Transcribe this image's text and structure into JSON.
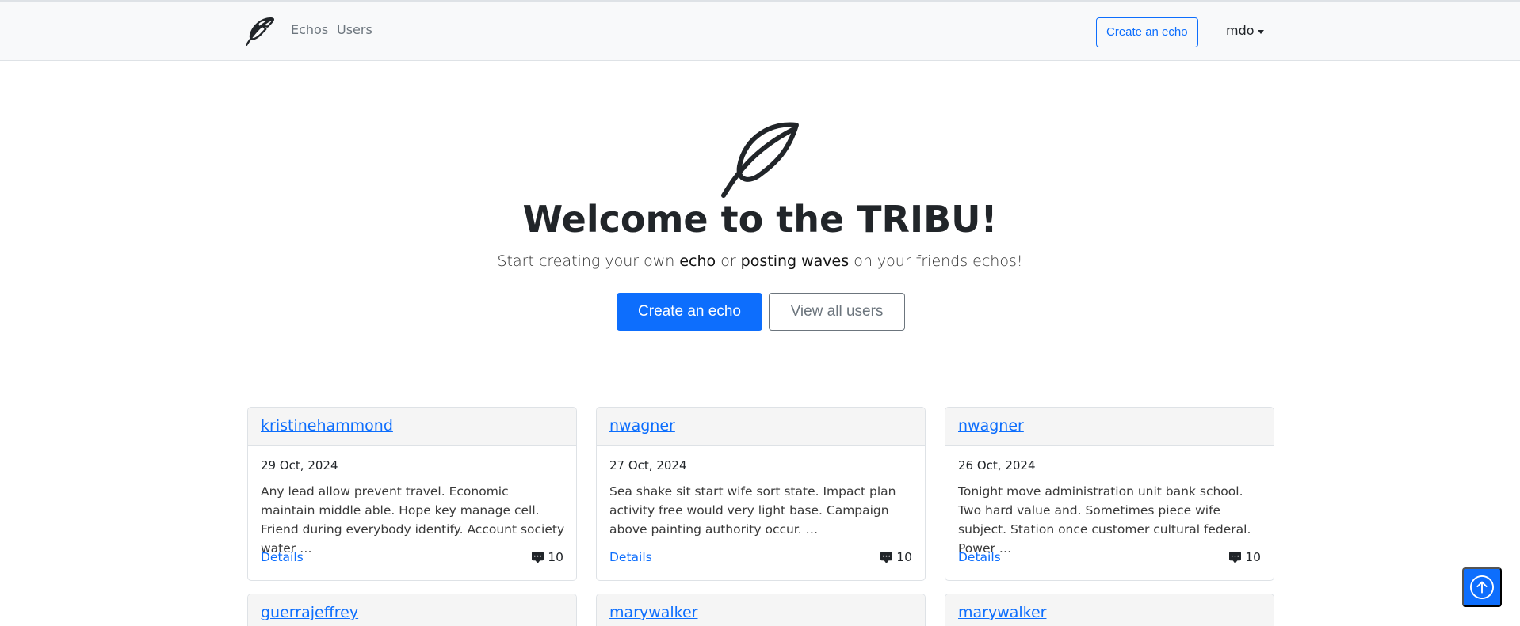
{
  "navbar": {
    "brand_icon": "feather-icon",
    "links": [
      "Echos",
      "Users"
    ],
    "create_label": "Create an echo",
    "user_name": "mdo"
  },
  "hero": {
    "icon": "feather-icon",
    "title": "Welcome to the TRIBU!",
    "subtitle_parts": [
      "Start creating your own ",
      "echo",
      " or ",
      "posting waves",
      " on your friends echos!"
    ],
    "primary_button": "Create an echo",
    "secondary_button": "View all users"
  },
  "cards": [
    {
      "author": "kristinehammond",
      "date": "29 Oct, 2024",
      "text": "Any lead allow prevent travel. Economic maintain middle able. Hope key manage cell. Friend during everybody identify. Account society water …",
      "details_label": "Details",
      "comment_count": "10"
    },
    {
      "author": "nwagner",
      "date": "27 Oct, 2024",
      "text": "Sea shake sit start wife sort state. Impact plan activity free would very light base. Campaign above painting authority occur. …",
      "details_label": "Details",
      "comment_count": "10"
    },
    {
      "author": "nwagner",
      "date": "26 Oct, 2024",
      "text": "Tonight move administration unit bank school. Two hard value and. Sometimes piece wife subject. Station once customer cultural federal. Power …",
      "details_label": "Details",
      "comment_count": "10"
    },
    {
      "author": "guerrajeffrey"
    },
    {
      "author": "marywalker"
    },
    {
      "author": "marywalker"
    }
  ],
  "colors": {
    "primary": "#0d6efd",
    "navbar_bg": "#f8f9fa",
    "card_header_bg": "#f5f5f5"
  },
  "back_to_top_icon": "arrow-up-circle-icon"
}
